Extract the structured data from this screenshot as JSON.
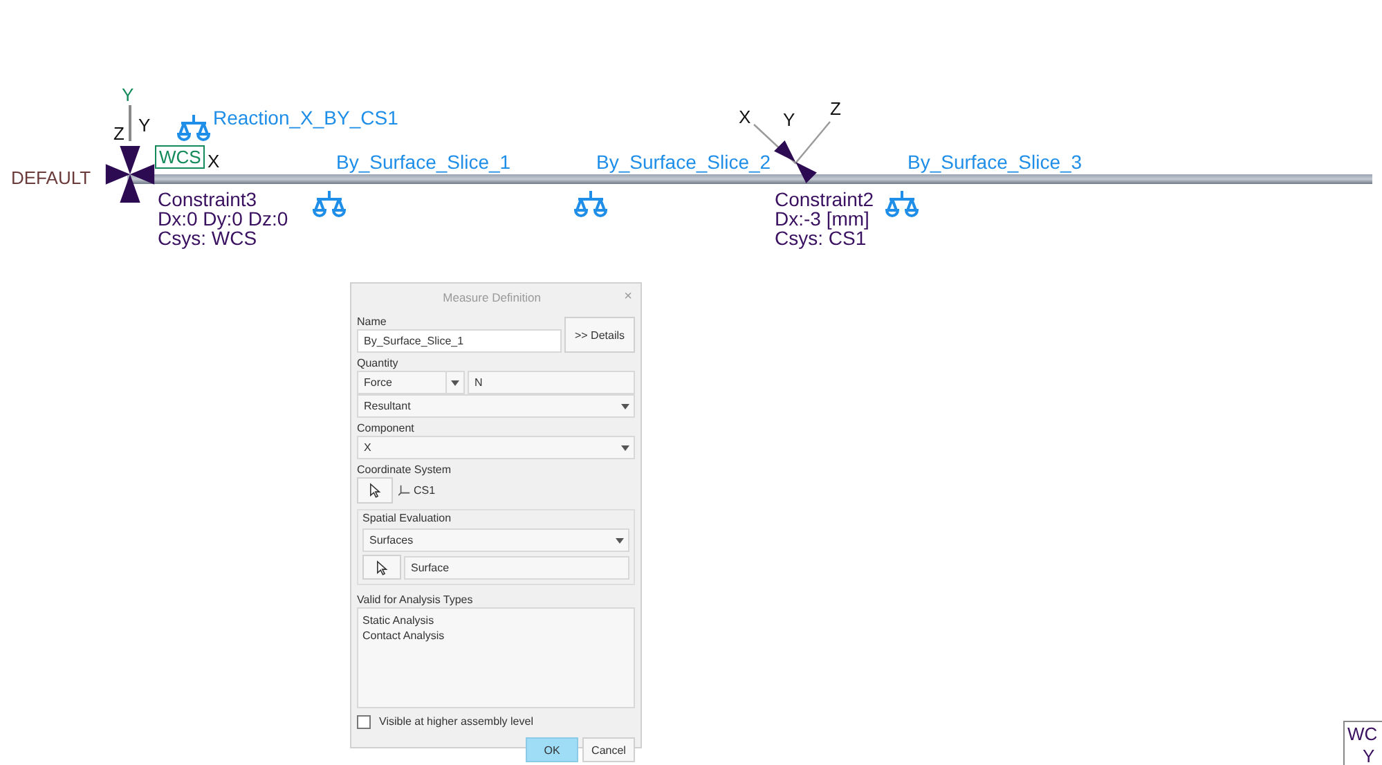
{
  "viewport": {
    "coordinate_systems": [
      {
        "name": "WCS",
        "axes": [
          "Y",
          "Z",
          "X"
        ]
      },
      {
        "axes": [
          "Y"
        ]
      },
      {
        "axes": [
          "X",
          "Z",
          "Y"
        ]
      }
    ],
    "default_label": "DEFAULT",
    "constraints": [
      {
        "name": "Constraint3",
        "values": "Dx:0 Dy:0 Dz:0",
        "csys": "Csys: WCS"
      },
      {
        "name": "Constraint2",
        "values": "Dx:-3 [mm]",
        "csys": "Csys: CS1"
      }
    ],
    "measures": [
      {
        "name": "Reaction_X_BY_CS1"
      },
      {
        "name": "By_Surface_Slice_1"
      },
      {
        "name": "By_Surface_Slice_2"
      },
      {
        "name": "By_Surface_Slice_3"
      }
    ],
    "corner_triad": {
      "label": "WC",
      "axis": "Y"
    }
  },
  "dialog": {
    "title": "Measure Definition",
    "close": "×",
    "name_label": "Name",
    "name_value": "By_Surface_Slice_1",
    "details_button": ">> Details",
    "quantity_label": "Quantity",
    "quantity": "Force",
    "unit": "N",
    "quantity_type": "Resultant",
    "component_label": "Component",
    "component": "X",
    "csys_label": "Coordinate System",
    "csys": "CS1",
    "spatial_group": "Spatial Evaluation",
    "spatial": "Surfaces",
    "selection": "Surface",
    "analysis_label": "Valid for Analysis Types",
    "analysis_types": [
      "Static Analysis",
      "Contact Analysis"
    ],
    "visible_option": {
      "label": "Visible at higher assembly level",
      "checked": false
    },
    "buttons": [
      {
        "label": "OK",
        "default": true
      },
      {
        "label": "Cancel",
        "default": false
      }
    ]
  }
}
